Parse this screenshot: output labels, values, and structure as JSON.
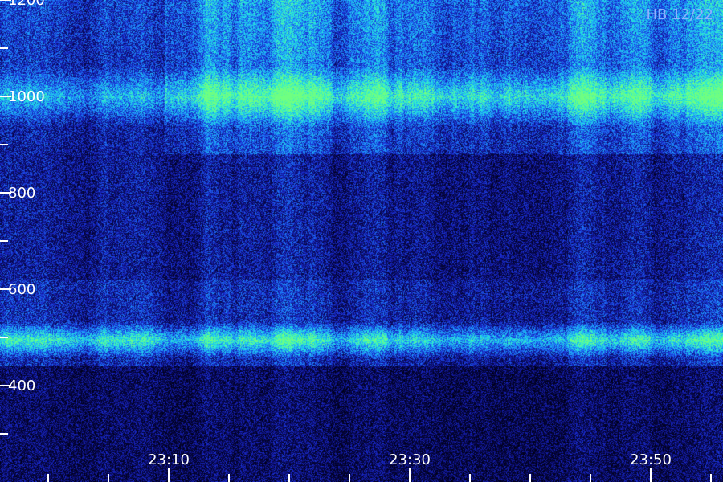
{
  "chart_data": {
    "type": "heatmap",
    "title": "HB 12/22",
    "y_ticks": [
      {
        "value": 1200,
        "label": "1200"
      },
      {
        "value": 1000,
        "label": "1000"
      },
      {
        "value": 800,
        "label": "800"
      },
      {
        "value": 600,
        "label": "600"
      },
      {
        "value": 400,
        "label": "400"
      }
    ],
    "y_minor_ticks": [
      1100,
      900,
      700,
      500,
      300
    ],
    "x_ticks": [
      {
        "minute": 10,
        "label": "23:10"
      },
      {
        "minute": 30,
        "label": "23:30"
      },
      {
        "minute": 50,
        "label": "23:50"
      }
    ],
    "x_minor_ticks": [
      0,
      5,
      15,
      20,
      25,
      35,
      40,
      45,
      55
    ],
    "ylim": [
      200,
      1200
    ],
    "xlim": [
      356,
      416
    ],
    "colormap": [
      "#000018",
      "#0a0a60",
      "#1a2ad0",
      "#1e90ff",
      "#22e8e0",
      "#70ff80"
    ],
    "bands": [
      {
        "y_from": 950,
        "y_to": 1050,
        "intensity": 0.85
      },
      {
        "y_from": 470,
        "y_to": 520,
        "intensity": 0.9
      }
    ]
  }
}
